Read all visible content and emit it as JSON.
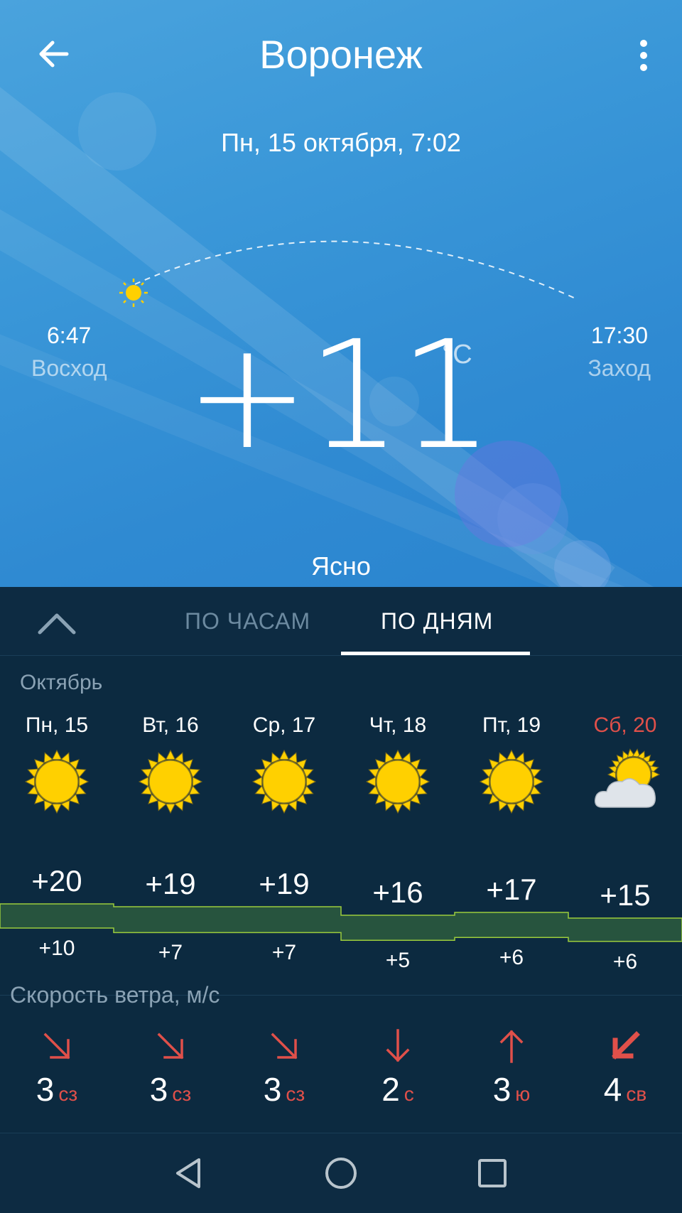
{
  "header": {
    "title": "Воронеж",
    "back_icon": "arrow-left-icon",
    "menu_icon": "more-vert-icon"
  },
  "current": {
    "datetime": "Пн, 15 октября, 7:02",
    "sunrise_time": "6:47",
    "sunrise_label": "Восход",
    "sunset_time": "17:30",
    "sunset_label": "Заход",
    "temperature": "+11",
    "unit": "°C",
    "condition": "Ясно",
    "sun_progress": 0.03
  },
  "tabs": {
    "hours": "ПО ЧАСАМ",
    "days": "ПО ДНЯМ",
    "active": "days"
  },
  "forecast": {
    "month": "Октябрь",
    "days": [
      {
        "label": "Пн, 15",
        "icon": "sun-icon",
        "high": "+20",
        "low": "+10",
        "weekend": false
      },
      {
        "label": "Вт, 16",
        "icon": "sun-icon",
        "high": "+19",
        "low": "+7",
        "weekend": false
      },
      {
        "label": "Ср, 17",
        "icon": "sun-icon",
        "high": "+19",
        "low": "+7",
        "weekend": false
      },
      {
        "label": "Чт, 18",
        "icon": "sun-icon",
        "high": "+16",
        "low": "+5",
        "weekend": false
      },
      {
        "label": "Пт, 19",
        "icon": "sun-icon",
        "high": "+17",
        "low": "+6",
        "weekend": false
      },
      {
        "label": "Сб, 20",
        "icon": "partly-cloudy-icon",
        "high": "+15",
        "low": "+6",
        "weekend": true
      }
    ]
  },
  "wind": {
    "title": "Скорость ветра, м/с",
    "days": [
      {
        "speed": "3",
        "dir": "сз",
        "arrow": "arrow-down-right-icon"
      },
      {
        "speed": "3",
        "dir": "сз",
        "arrow": "arrow-down-right-icon"
      },
      {
        "speed": "3",
        "dir": "сз",
        "arrow": "arrow-down-right-icon"
      },
      {
        "speed": "2",
        "dir": "с",
        "arrow": "arrow-down-icon"
      },
      {
        "speed": "3",
        "dir": "ю",
        "arrow": "arrow-up-icon"
      },
      {
        "speed": "4",
        "dir": "св",
        "arrow": "arrow-down-left-icon"
      }
    ]
  },
  "colors": {
    "weekend": "#e0504a",
    "wind": "#e0504a",
    "band_fill": "#27543e",
    "band_line": "#9ccc3c",
    "sun": "#ffd000"
  },
  "navbar": {
    "back_icon": "nav-back-icon",
    "home_icon": "nav-home-icon",
    "recents_icon": "nav-recents-icon"
  }
}
